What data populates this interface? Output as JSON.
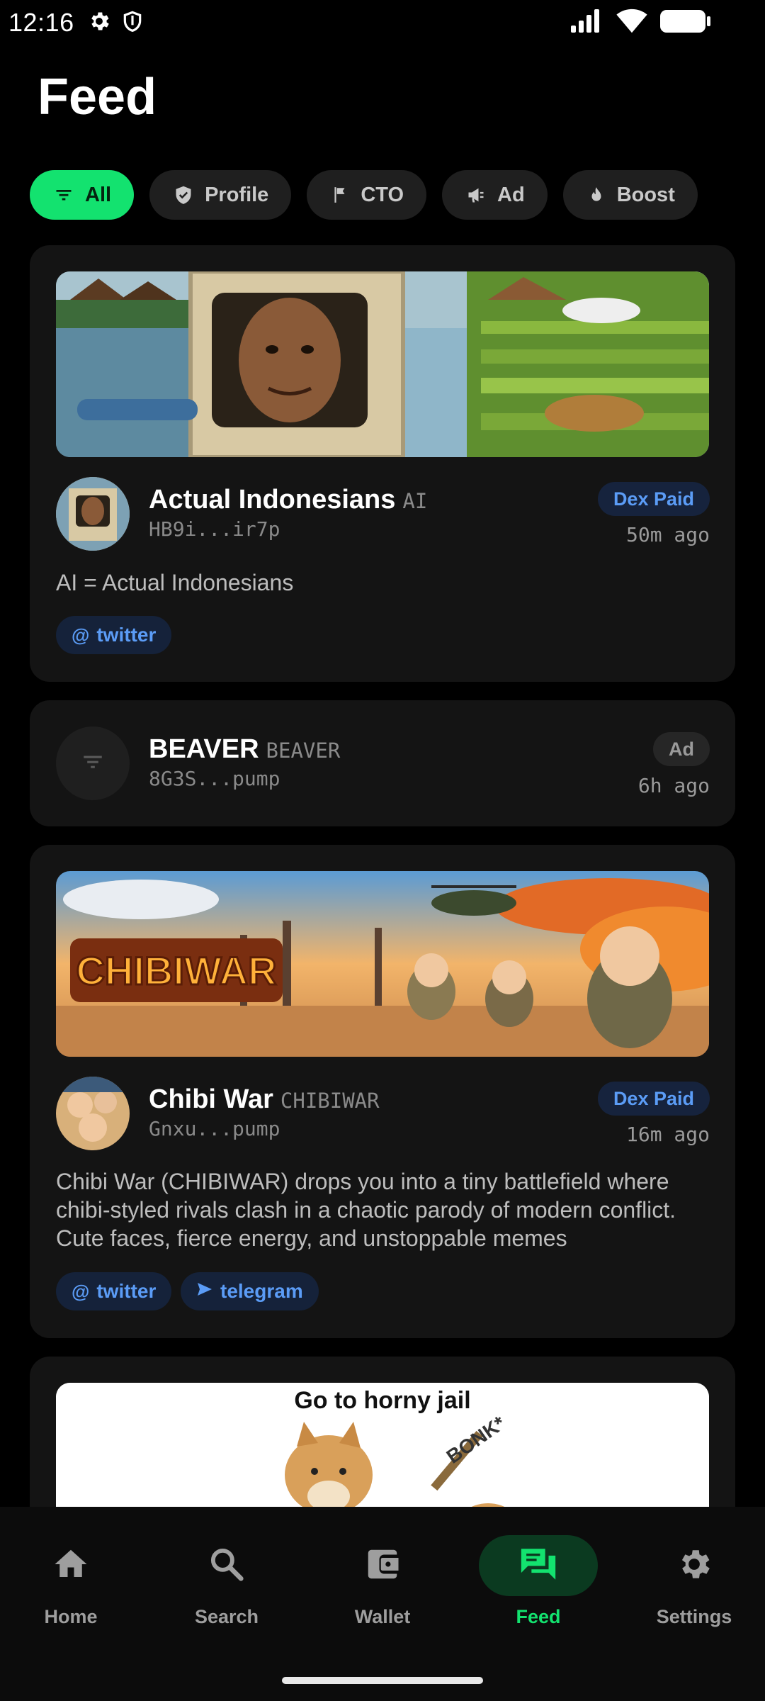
{
  "status_bar": {
    "time": "12:16",
    "icons": [
      "gear-icon",
      "shield-icon",
      "cell-signal-icon",
      "wifi-icon",
      "battery-icon"
    ]
  },
  "page": {
    "title": "Feed"
  },
  "filters": [
    {
      "label": "All",
      "icon": "filter-icon",
      "active": true
    },
    {
      "label": "Profile",
      "icon": "shield-check-icon",
      "active": false
    },
    {
      "label": "CTO",
      "icon": "flag-icon",
      "active": false
    },
    {
      "label": "Ad",
      "icon": "megaphone-icon",
      "active": false
    },
    {
      "label": "Boost",
      "icon": "flame-icon",
      "active": false
    }
  ],
  "feed": [
    {
      "name": "Actual Indonesians",
      "symbol": "AI",
      "address": "HB9i...ir7p",
      "badge": "Dex Paid",
      "time": "50m ago",
      "description": "AI = Actual Indonesians",
      "links": [
        "twitter"
      ]
    },
    {
      "name": "BEAVER",
      "symbol": "BEAVER",
      "address": "8G3S...pump",
      "badge": "Ad",
      "time": "6h ago"
    },
    {
      "name": "Chibi War",
      "symbol": "CHIBIWAR",
      "address": "Gnxu...pump",
      "badge": "Dex Paid",
      "time": "16m ago",
      "banner_text": "CHIBIWAR",
      "description": "Chibi War (CHIBIWAR) drops you into a tiny battlefield where chibi-styled rivals clash in a chaotic parody of modern conflict. Cute faces, fierce energy, and unstoppable memes",
      "links": [
        "twitter",
        "telegram"
      ]
    },
    {
      "banner_text": "Go to horny jail",
      "banner_sub": "BONK*"
    }
  ],
  "nav": [
    {
      "label": "Home",
      "icon": "home-icon",
      "active": false
    },
    {
      "label": "Search",
      "icon": "search-icon",
      "active": false
    },
    {
      "label": "Wallet",
      "icon": "wallet-icon",
      "active": false
    },
    {
      "label": "Feed",
      "icon": "chat-icon",
      "active": true
    },
    {
      "label": "Settings",
      "icon": "gear-icon",
      "active": false
    }
  ],
  "colors": {
    "accent": "#13e26f",
    "background": "#000000",
    "card": "#141414",
    "link_blue": "#5b9cf6"
  }
}
